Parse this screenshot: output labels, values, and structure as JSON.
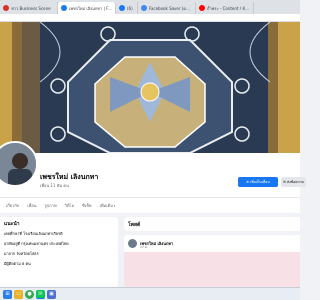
{
  "browser": {
    "tabs": [
      {
        "label": "ข่าว Business Scene",
        "color": "#d93025"
      },
      {
        "label": "เพชรใหม่ เลิงนกทา | Facebook",
        "color": "#1877f2",
        "active": true
      },
      {
        "label": "(6)",
        "color": "#1877f2",
        "badge": "6"
      },
      {
        "label": "Facebook Saver (ดาวน์โหลดวิดีโอ)",
        "color": "#4285f4"
      },
      {
        "label": "ถ้ำพระ - Content / ข้อมูล",
        "color": "#ff0000"
      }
    ]
  },
  "profile": {
    "name": "เพชรใหม่ เลิงนกทา",
    "friends": "เพื่อน 11 พัน คน",
    "add_friend_label": "เพิ่มเป็นเพื่อน",
    "message_label": "ส่งข้อความ",
    "add_icon": "person-plus-icon",
    "message_icon": "messenger-icon"
  },
  "nav": {
    "tabs": [
      "เกี่ยวกับ",
      "เพื่อน",
      "รูปภาพ",
      "วิดีโอ",
      "ซีเช็ค",
      "เพิ่มเติม"
    ]
  },
  "intro": {
    "title": "แนะนำ",
    "rows": [
      "เคยศึกษาที่ โรงเรียนเลิงนกทาเกียรติ",
      "อาศัยอยู่ที่ กรุงเทพมหานคร ประเทศไทย",
      "มาจาก จังหวัดยโสธร",
      "มีผู้ติดตาม 8 คน"
    ]
  },
  "posts": {
    "title": "โพสต์",
    "author": "เพชรใหม่ เลิงนกทา",
    "time": "17 ม. ·"
  },
  "taskbar": {
    "icons": [
      {
        "name": "start-icon",
        "color": "#2b7de9"
      },
      {
        "name": "file-explorer-icon",
        "color": "#e8b22b"
      },
      {
        "name": "chrome-icon",
        "color": "#34a853"
      },
      {
        "name": "line-icon",
        "color": "#06c755"
      },
      {
        "name": "photos-icon",
        "color": "#4a6fd1"
      }
    ]
  }
}
